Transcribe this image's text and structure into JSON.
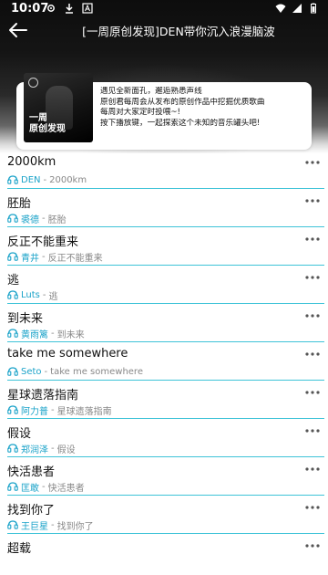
{
  "status_bar": {
    "time": "10:07"
  },
  "header": {
    "title": "[一周原创发现]DEN带你沉入浪漫脑波"
  },
  "playlist_card": {
    "cover_text": "一周\n原创发现",
    "description": [
      "遇见全新面孔，邂逅熟悉声线",
      "原创君每周会从发布的原创作品中挖掘优质歌曲",
      "每周对大家定时投喂~!",
      "按下播放键，一起探索这个未知的音乐罐头吧!"
    ]
  },
  "songs": [
    {
      "title": "2000km",
      "artist": "DEN",
      "album": "2000km"
    },
    {
      "title": "胚胎",
      "artist": "裘德",
      "album": "胚胎"
    },
    {
      "title": "反正不能重来",
      "artist": "青井",
      "album": "反正不能重来"
    },
    {
      "title": "逃",
      "artist": "Luts",
      "album": "逃"
    },
    {
      "title": "到未来",
      "artist": "黄雨篱",
      "album": "到未来"
    },
    {
      "title": "take me somewhere",
      "artist": "Seto",
      "album": "take me somewhere"
    },
    {
      "title": "星球遗落指南",
      "artist": "阿力普",
      "album": "星球遗落指南"
    },
    {
      "title": "假设",
      "artist": "郑润泽",
      "album": "假设"
    },
    {
      "title": "快活患者",
      "artist": "匡敢",
      "album": "快活患者"
    },
    {
      "title": "找到你了",
      "artist": "王巨星",
      "album": "找到你了"
    },
    {
      "title": "超载",
      "artist": "",
      "album": ""
    }
  ],
  "separator": "-",
  "colors": {
    "accent": "#1ba3c9",
    "divider": "#3ec3d8"
  }
}
